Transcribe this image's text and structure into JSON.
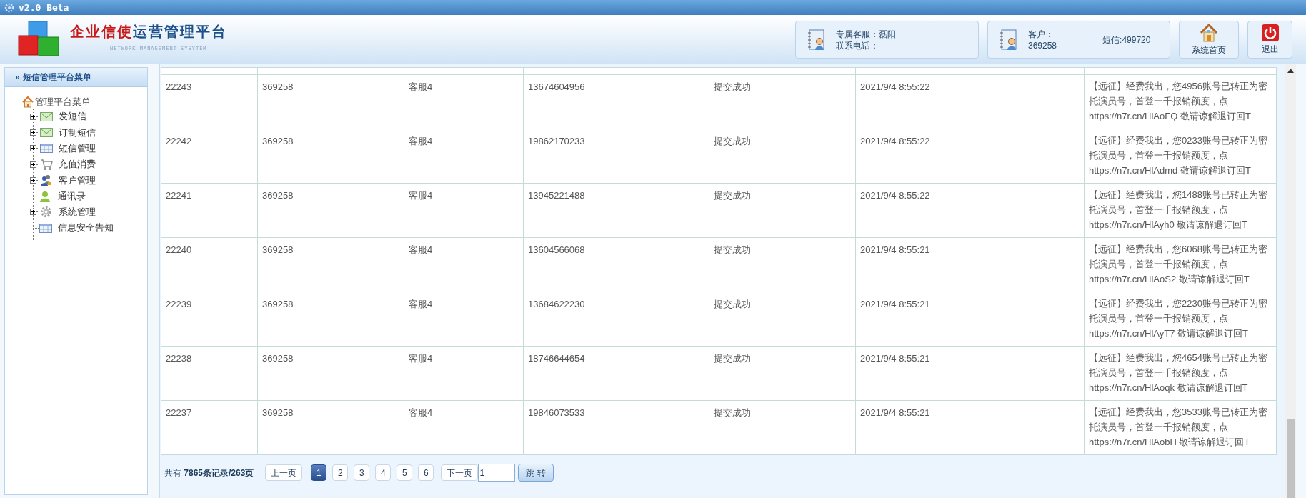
{
  "title_bar": {
    "version": "v2.0 Beta"
  },
  "header": {
    "brand_red": "企业信使",
    "brand_blue": "运营管理平台",
    "subtitle": "NETWORK MANAGEMENT SYSYTEM",
    "service": {
      "line_1": "专属客服：磊阳",
      "line_2": "联系电话："
    },
    "account": {
      "customer_label": "客户：",
      "customer_id": "369258",
      "sms": "短信:499720"
    },
    "buttons": [
      {
        "kind": "home",
        "label": "系统首页"
      },
      {
        "kind": "exit",
        "label": "退出"
      }
    ]
  },
  "sidebar": {
    "title": "»",
    "heading": "短信管理平台菜单",
    "root": "管理平台菜单",
    "items": [
      {
        "label": "发短信",
        "kind": "mail",
        "expanded": false
      },
      {
        "label": "订制短信",
        "kind": "mail",
        "expanded": false
      },
      {
        "label": "短信管理",
        "kind": "table",
        "expanded": false
      },
      {
        "label": "充值消费",
        "kind": "cart",
        "expanded": false
      },
      {
        "label": "客户管理",
        "kind": "users",
        "expanded": false
      },
      {
        "label": "通讯录",
        "kind": "person"
      },
      {
        "label": "系统管理",
        "kind": "gear",
        "expanded": false
      },
      {
        "label": "信息安全告知",
        "kind": "table"
      }
    ]
  },
  "table": {
    "rows": [
      {
        "id": "22243",
        "account": "369258",
        "user": "客服4",
        "phone": "13674604956",
        "status": "提交成功",
        "time": "2021/9/4 8:55:22",
        "message": "【远征】经费我出，您4956账号已转正为密托演员号，首登一千报销额度，点 https://n7r.cn/HlAoFQ 敬请谅解退订回T"
      },
      {
        "id": "22242",
        "account": "369258",
        "user": "客服4",
        "phone": "19862170233",
        "status": "提交成功",
        "time": "2021/9/4 8:55:22",
        "message": "【远征】经费我出，您0233账号已转正为密托演员号，首登一千报销额度，点 https://n7r.cn/HlAdmd 敬请谅解退订回T"
      },
      {
        "id": "22241",
        "account": "369258",
        "user": "客服4",
        "phone": "13945221488",
        "status": "提交成功",
        "time": "2021/9/4 8:55:22",
        "message": "【远征】经费我出，您1488账号已转正为密托演员号，首登一千报销额度，点 https://n7r.cn/HlAyh0 敬请谅解退订回T"
      },
      {
        "id": "22240",
        "account": "369258",
        "user": "客服4",
        "phone": "13604566068",
        "status": "提交成功",
        "time": "2021/9/4 8:55:21",
        "message": "【远征】经费我出，您6068账号已转正为密托演员号，首登一千报销额度，点 https://n7r.cn/HlAoS2 敬请谅解退订回T"
      },
      {
        "id": "22239",
        "account": "369258",
        "user": "客服4",
        "phone": "13684622230",
        "status": "提交成功",
        "time": "2021/9/4 8:55:21",
        "message": "【远征】经费我出，您2230账号已转正为密托演员号，首登一千报销额度，点 https://n7r.cn/HlAyT7 敬请谅解退订回T"
      },
      {
        "id": "22238",
        "account": "369258",
        "user": "客服4",
        "phone": "18746644654",
        "status": "提交成功",
        "time": "2021/9/4 8:55:21",
        "message": "【远征】经费我出，您4654账号已转正为密托演员号，首登一千报销额度，点 https://n7r.cn/HlAoqk 敬请谅解退订回T"
      },
      {
        "id": "22237",
        "account": "369258",
        "user": "客服4",
        "phone": "19846073533",
        "status": "提交成功",
        "time": "2021/9/4 8:55:21",
        "message": "【远征】经费我出，您3533账号已转正为密托演员号，首登一千报销额度，点 https://n7r.cn/HlAobH 敬请谅解退订回T"
      }
    ]
  },
  "pagination": {
    "summary": "共有 **7865条记录/263页**",
    "prev": "上一页",
    "pages": [
      {
        "label": "1",
        "selected": true
      },
      {
        "label": "2",
        "selected": false
      },
      {
        "label": "3",
        "selected": false
      },
      {
        "label": "4",
        "selected": false
      },
      {
        "label": "5",
        "selected": false
      },
      {
        "label": "6",
        "selected": false
      }
    ],
    "next": "下一页",
    "goto_value": "1",
    "goto_button": "跳 转"
  }
}
